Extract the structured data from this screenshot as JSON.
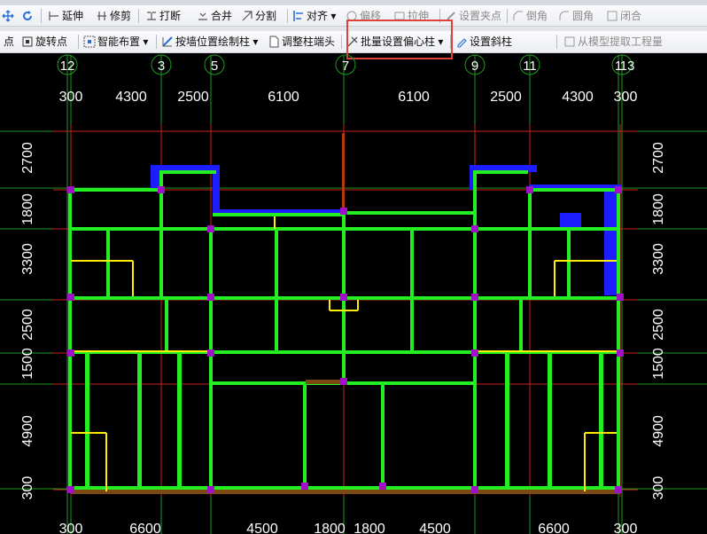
{
  "toolbar1": {
    "extend": "延伸",
    "trim": "修剪",
    "break": "打断",
    "merge": "合并",
    "split": "分割",
    "align": "对齐",
    "offset": "偏移",
    "stretch": "拉伸",
    "set_grip": "设置夹点",
    "chamfer": "倒角",
    "fillet": "圆角",
    "close": "闭合"
  },
  "toolbar2": {
    "point": "点",
    "rotate_point": "旋转点",
    "smart_layout": "智能布置",
    "draw_by_wall": "按墙位置绘制柱",
    "adjust_column_end": "调整柱端头",
    "batch_eccentric": "批量设置偏心柱",
    "set_inclined": "设置斜柱",
    "extract_from_model": "从模型提取工程量"
  },
  "axes_top": [
    "12",
    "3",
    "5",
    "7",
    "9",
    "11",
    "1",
    "13"
  ],
  "dims_top": [
    "300",
    "4300",
    "2500",
    "6100",
    "6100",
    "2500",
    "4300",
    "300"
  ],
  "dims_bottom": [
    "300",
    "6600",
    "4500",
    "1800",
    "1800",
    "4500",
    "6600",
    "300"
  ],
  "dims_left": [
    "2700",
    "1800",
    "3300",
    "2500",
    "1500",
    "4900",
    "300"
  ],
  "dims_right": [
    "2700",
    "1800",
    "3300",
    "2500",
    "1500",
    "4900",
    "300"
  ],
  "colors": {
    "wall": "#22ee22",
    "column": "#a010c8",
    "beam": "#ffee00",
    "slab_edge": "#1d1dff",
    "axis": "#cc2222",
    "grid": "#1f9a1f"
  }
}
